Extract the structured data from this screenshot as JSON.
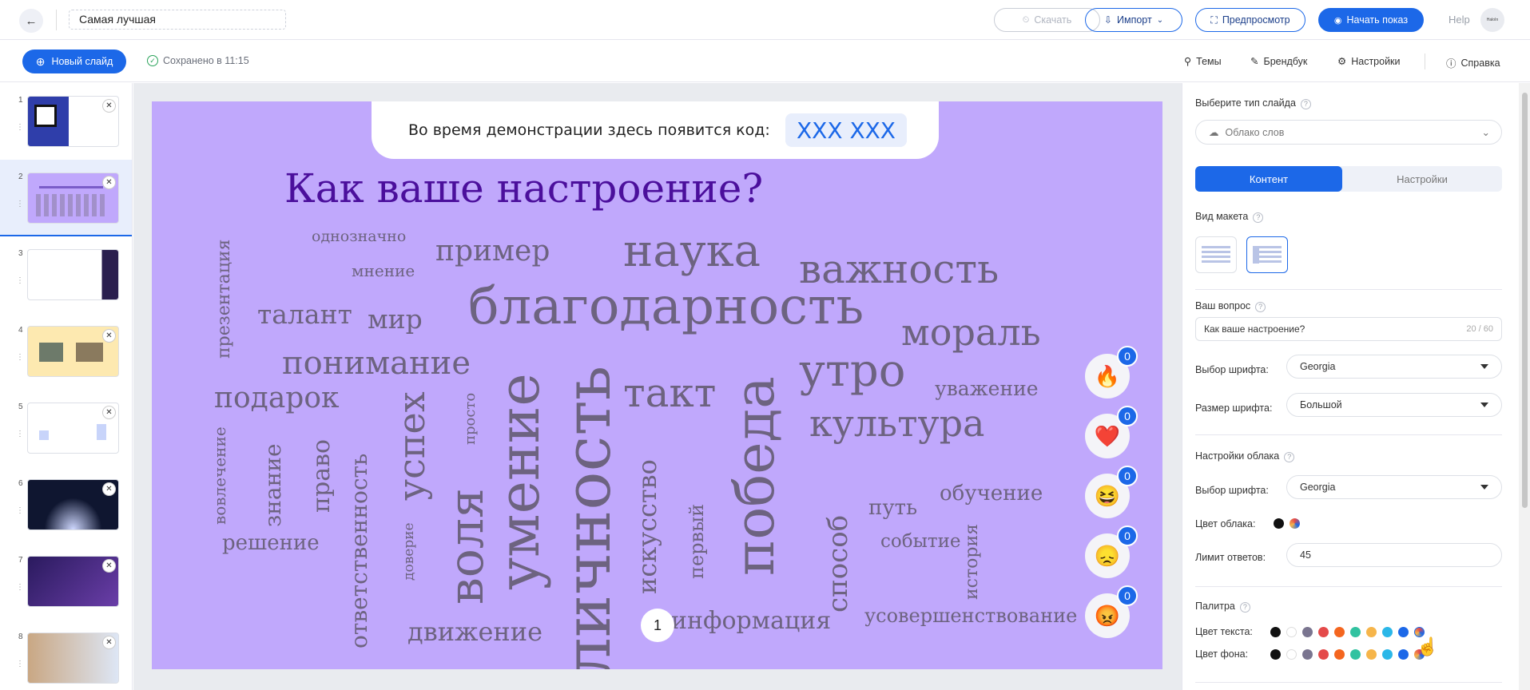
{
  "header": {
    "back": "←",
    "title": "Самая лучшая",
    "download_label": "Скачать",
    "import_label": "Импорт",
    "preview_label": "Предпросмотр",
    "start_label": "Начать показ",
    "help_label": "Help",
    "avatar_text": "HaloIn"
  },
  "subbar": {
    "new_slide_label": "Новый слайд",
    "saved_text": "Сохранено в 11:15",
    "themes_label": "Темы",
    "brandbook_label": "Брендбук",
    "settings_label": "Настройки",
    "help_label": "Справка"
  },
  "thumbnails": [
    {
      "num": "1",
      "bg": "#2f3eaa"
    },
    {
      "num": "2",
      "bg": "#c0a8fc"
    },
    {
      "num": "3",
      "bg": "#ffffff"
    },
    {
      "num": "4",
      "bg": "#fde9b0"
    },
    {
      "num": "5",
      "bg": "#ffffff"
    },
    {
      "num": "6",
      "bg": "#0f1630"
    },
    {
      "num": "7",
      "bg": "#3a1f6e"
    },
    {
      "num": "8",
      "bg": "#dde6f5"
    }
  ],
  "slide": {
    "code_text": "Во время демонстрации здесь появится код:",
    "code_value": "XXX XXX",
    "question": "Как ваше настроение?",
    "page_number": "1",
    "reactions": [
      {
        "emoji": "🔥",
        "count": "0"
      },
      {
        "emoji": "❤️",
        "count": "0"
      },
      {
        "emoji": "😆",
        "count": "0"
      },
      {
        "emoji": "😞",
        "count": "0"
      },
      {
        "emoji": "😡",
        "count": "0"
      }
    ],
    "words": [
      "однозначно",
      "мнение",
      "пример",
      "наука",
      "важность",
      "презентация",
      "талант",
      "мир",
      "благодарность",
      "мораль",
      "понимание",
      "утро",
      "уважение",
      "подарок",
      "такт",
      "культура",
      "успех",
      "просто",
      "вовлечение",
      "знание",
      "право",
      "ответственность",
      "доверие",
      "воля",
      "умение",
      "личность",
      "искусство",
      "первый",
      "победа",
      "способ",
      "путь",
      "обучение",
      "событие",
      "история",
      "решение",
      "движение",
      "информация",
      "усовершенствование"
    ]
  },
  "panel": {
    "slide_type_label": "Выберите тип слайда",
    "slide_type_value": "Облако слов",
    "tab_content": "Контент",
    "tab_settings": "Настройки",
    "layout_label": "Вид макета",
    "question_label": "Ваш вопрос",
    "question_value": "Как ваше настроение?",
    "question_counter": "20 / 60",
    "font_label": "Выбор шрифта:",
    "font_value": "Georgia",
    "size_label": "Размер шрифта:",
    "size_value": "Большой",
    "cloud_settings_label": "Настройки облака",
    "cloud_font_label": "Выбор шрифта:",
    "cloud_font_value": "Georgia",
    "cloud_color_label": "Цвет облака:",
    "limit_label": "Лимит ответов:",
    "limit_value": "45",
    "palette_label": "Палитра",
    "text_color_label": "Цвет текста:",
    "bg_color_label": "Цвет фона:",
    "palette_colors": [
      "#111111",
      "#ffffff",
      "#7a7590",
      "#e44a4a",
      "#f4661f",
      "#31c2a0",
      "#f6b54a",
      "#2bb7e8",
      "#1c68e8"
    ]
  }
}
